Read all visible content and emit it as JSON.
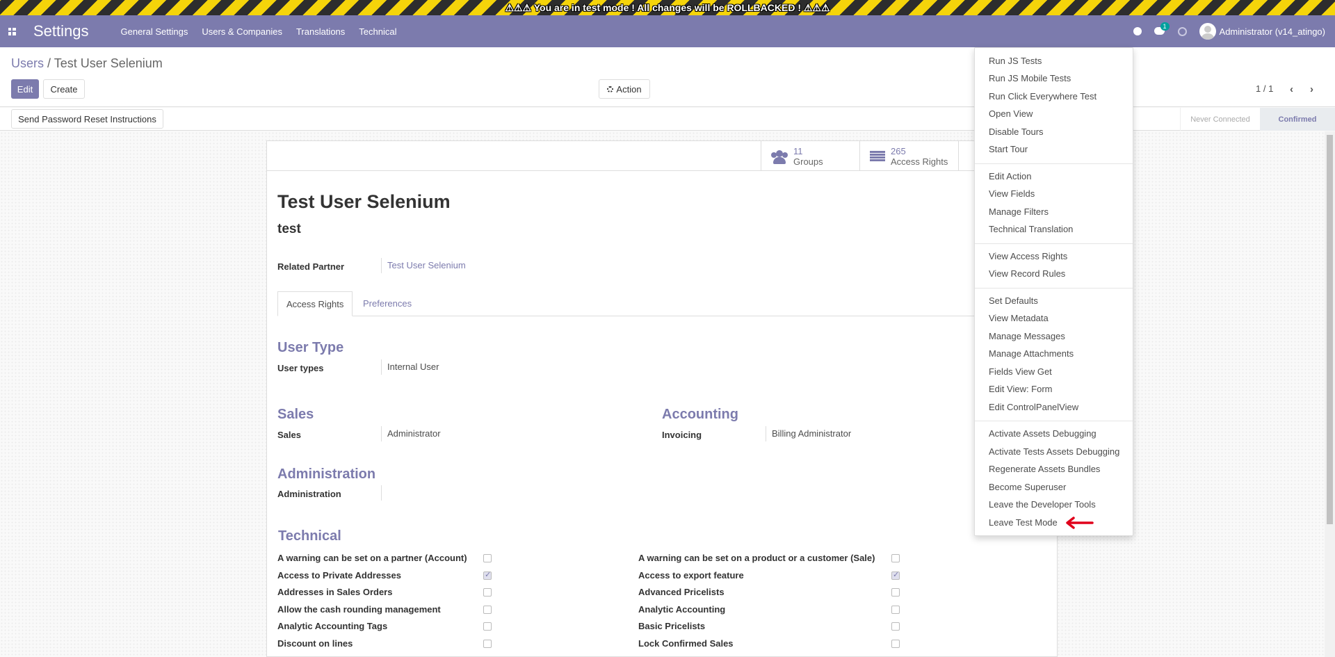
{
  "banner": {
    "text": "⚠⚠⚠ You are in test mode ! All changes will be ROLLBACKED ! ⚠⚠⚠"
  },
  "navbar": {
    "brand": "Settings",
    "menu": [
      "General Settings",
      "Users & Companies",
      "Translations",
      "Technical"
    ],
    "messages_badge": "1",
    "user_label": "Administrator (v14_atingo)"
  },
  "control_panel": {
    "breadcrumb_parent": "Users",
    "breadcrumb_separator": "/",
    "breadcrumb_current": "Test User Selenium",
    "edit_label": "Edit",
    "create_label": "Create",
    "action_label": "Action",
    "pager": "1 / 1"
  },
  "statusbar": {
    "reset_button": "Send Password Reset Instructions",
    "stages": [
      "Never Connected",
      "Confirmed"
    ],
    "active_stage": "Confirmed"
  },
  "form": {
    "stat_buttons": [
      {
        "value": "11",
        "label": "Groups",
        "icon": "users-icon"
      },
      {
        "value": "265",
        "label": "Access Rights",
        "icon": "list-icon"
      }
    ],
    "name": "Test User Selenium",
    "login": "test",
    "related_partner_label": "Related Partner",
    "related_partner_value": "Test User Selenium",
    "tabs": [
      "Access Rights",
      "Preferences"
    ],
    "user_type": {
      "title": "User Type",
      "label": "User types",
      "value": "Internal User"
    },
    "sales": {
      "title": "Sales",
      "label": "Sales",
      "value": "Administrator"
    },
    "accounting": {
      "title": "Accounting",
      "label": "Invoicing",
      "value": "Billing Administrator"
    },
    "administration": {
      "title": "Administration",
      "label": "Administration",
      "value": ""
    },
    "technical": {
      "title": "Technical",
      "left": [
        {
          "label": "A warning can be set on a partner (Account)",
          "checked": false
        },
        {
          "label": "Access to Private Addresses",
          "checked": true
        },
        {
          "label": "Addresses in Sales Orders",
          "checked": false
        },
        {
          "label": "Allow the cash rounding management",
          "checked": false
        },
        {
          "label": "Analytic Accounting Tags",
          "checked": false
        },
        {
          "label": "Discount on lines",
          "checked": false
        }
      ],
      "right": [
        {
          "label": "A warning can be set on a product or a customer (Sale)",
          "checked": false
        },
        {
          "label": "Access to export feature",
          "checked": true
        },
        {
          "label": "Advanced Pricelists",
          "checked": false
        },
        {
          "label": "Analytic Accounting",
          "checked": false
        },
        {
          "label": "Basic Pricelists",
          "checked": false
        },
        {
          "label": "Lock Confirmed Sales",
          "checked": false
        }
      ]
    }
  },
  "debug_menu": {
    "groups": [
      [
        "Run JS Tests",
        "Run JS Mobile Tests",
        "Run Click Everywhere Test",
        "Open View",
        "Disable Tours",
        "Start Tour"
      ],
      [
        "Edit Action",
        "View Fields",
        "Manage Filters",
        "Technical Translation"
      ],
      [
        "View Access Rights",
        "View Record Rules"
      ],
      [
        "Set Defaults",
        "View Metadata",
        "Manage Messages",
        "Manage Attachments",
        "Fields View Get",
        "Edit View: Form",
        "Edit ControlPanelView"
      ],
      [
        "Activate Assets Debugging",
        "Activate Tests Assets Debugging",
        "Regenerate Assets Bundles",
        "Become Superuser",
        "Leave the Developer Tools",
        "Leave Test Mode"
      ]
    ]
  },
  "colors": {
    "brand": "#7c7bad",
    "banner_yellow": "#f5d40a",
    "badge": "#00a09d",
    "arrow": "#e0001b"
  }
}
